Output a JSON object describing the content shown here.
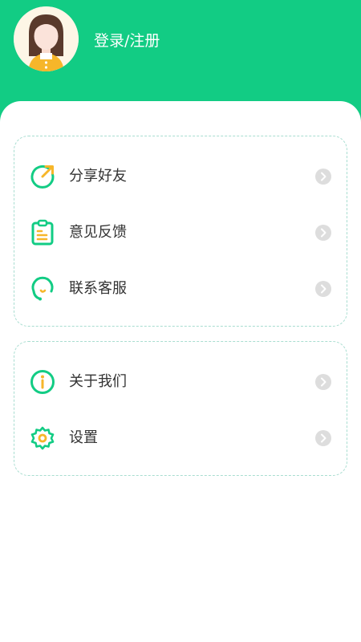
{
  "header": {
    "login_label": "登录/注册",
    "background_color": "#12cc84"
  },
  "menu": {
    "group1": [
      {
        "label": "分享好友",
        "icon": "share-icon"
      },
      {
        "label": "意见反馈",
        "icon": "feedback-clipboard-icon"
      },
      {
        "label": "联系客服",
        "icon": "customer-service-icon"
      }
    ],
    "group2": [
      {
        "label": "关于我们",
        "icon": "info-icon"
      },
      {
        "label": "设置",
        "icon": "gear-icon"
      }
    ]
  },
  "colors": {
    "accent_green": "#12cc84",
    "accent_yellow": "#f6b62a",
    "chevron_bg": "#dddddd",
    "text": "#333333"
  }
}
